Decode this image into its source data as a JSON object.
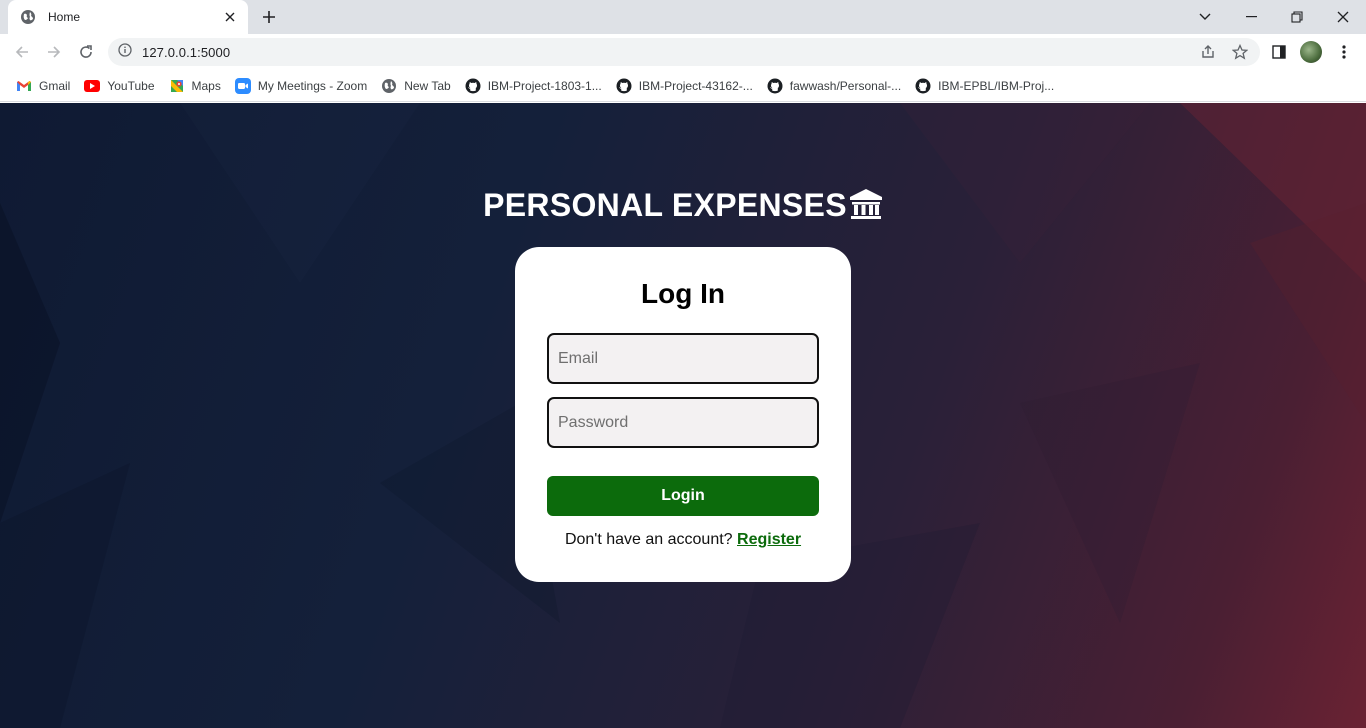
{
  "browser": {
    "tab_title": "Home",
    "url": "127.0.0.1:5000",
    "bookmarks": [
      {
        "label": "Gmail",
        "icon": "gmail-icon"
      },
      {
        "label": "YouTube",
        "icon": "youtube-icon"
      },
      {
        "label": "Maps",
        "icon": "maps-icon"
      },
      {
        "label": "My Meetings - Zoom",
        "icon": "zoom-icon"
      },
      {
        "label": "New Tab",
        "icon": "globe-icon"
      },
      {
        "label": "IBM-Project-1803-1...",
        "icon": "github-icon"
      },
      {
        "label": "IBM-Project-43162-...",
        "icon": "github-icon"
      },
      {
        "label": "fawwash/Personal-...",
        "icon": "github-icon"
      },
      {
        "label": "IBM-EPBL/IBM-Proj...",
        "icon": "github-icon"
      }
    ]
  },
  "page": {
    "heading": "PERSONAL EXPENSES",
    "heading_icon": "bank-icon",
    "card": {
      "title": "Log In",
      "email_placeholder": "Email",
      "email_value": "",
      "password_placeholder": "Password",
      "password_value": "",
      "login_label": "Login",
      "register_prompt": "Don't have an account?",
      "register_link": "Register"
    }
  },
  "colors": {
    "primary_button": "#0c6b0c",
    "background_left": "#0f1a33",
    "background_right": "#6a2233"
  }
}
